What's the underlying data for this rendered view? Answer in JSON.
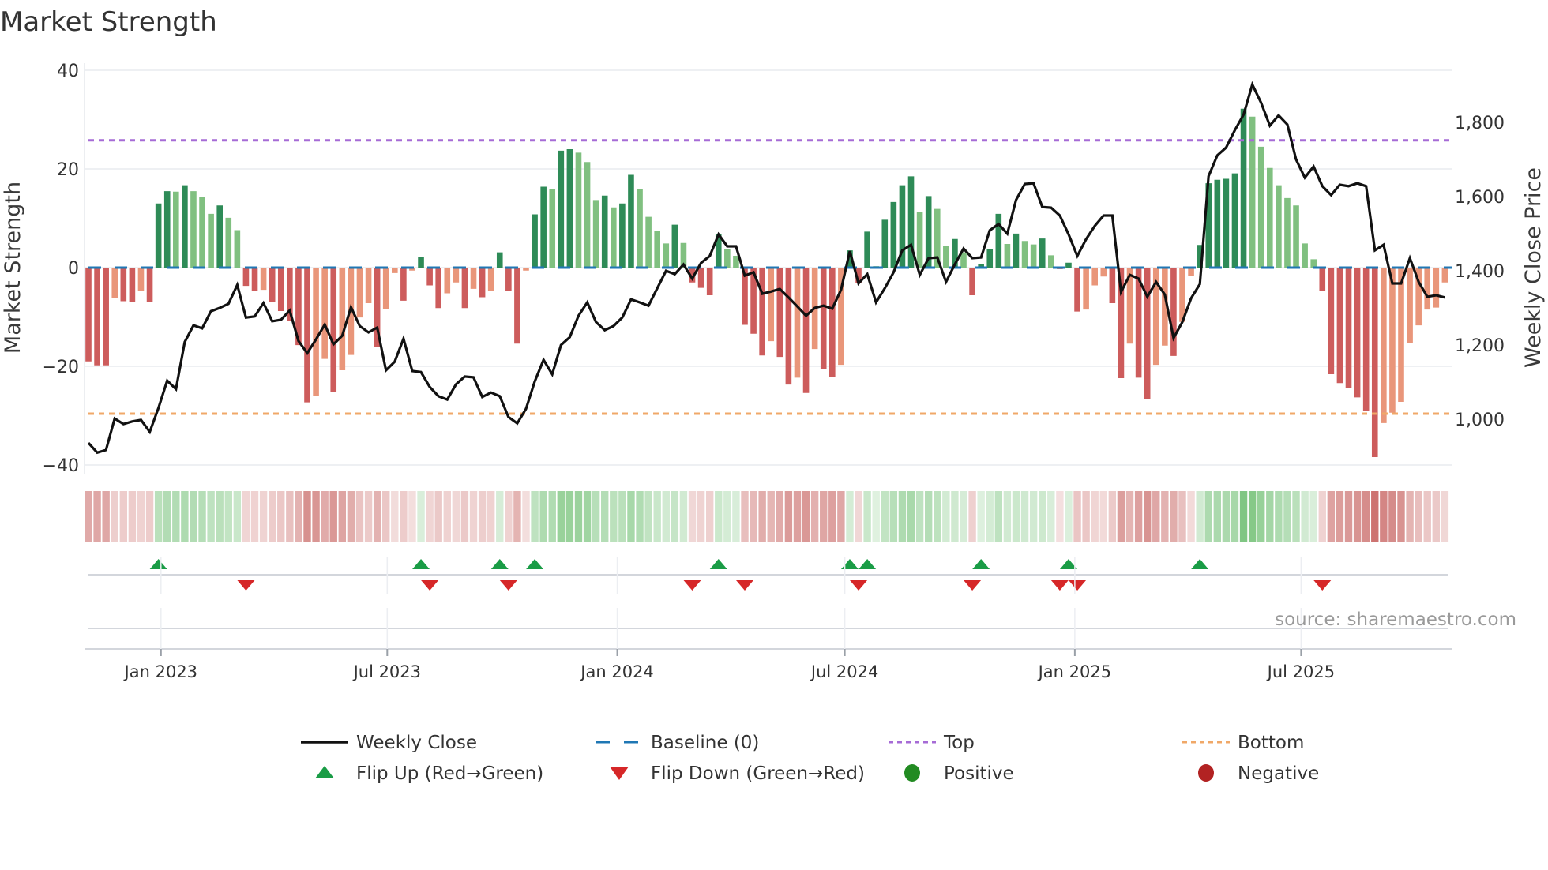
{
  "chart_data": {
    "type": "bar",
    "title": "Market Strength",
    "ylabel": "Market Strength",
    "y2label": "Weekly Close Price",
    "ylim": [
      -40,
      40
    ],
    "y2lim": [
      880,
      1930
    ],
    "yticks": [
      "40",
      "20",
      "0",
      "−20",
      "−40"
    ],
    "ytick_values": [
      40,
      20,
      0,
      -20,
      -40
    ],
    "y2ticks": [
      "1,000",
      "1,200",
      "1,400",
      "1,600",
      "1,800"
    ],
    "y2tick_values": [
      1000,
      1200,
      1400,
      1600,
      1800
    ],
    "x_start": "2022-11-04",
    "x_step_days": 7,
    "xticks": [
      {
        "label": "Jan 2023",
        "date": "2023-01-01"
      },
      {
        "label": "Jul 2023",
        "date": "2023-07-01"
      },
      {
        "label": "Jan 2024",
        "date": "2024-01-01"
      },
      {
        "label": "Jul 2024",
        "date": "2024-07-01"
      },
      {
        "label": "Jan 2025",
        "date": "2025-01-01"
      },
      {
        "label": "Jul 2025",
        "date": "2025-07-01"
      }
    ],
    "top_level": 25.8,
    "bottom_level": -29.6,
    "strength": [
      -19,
      -19.8,
      -19.8,
      -6.2,
      -6.8,
      -6.9,
      -4.8,
      -6.9,
      13,
      15.5,
      15.4,
      16.7,
      15.5,
      14.3,
      10.9,
      12.6,
      10.1,
      7.6,
      -3.7,
      -4.8,
      -4.5,
      -6.9,
      -8.8,
      -10.8,
      -15.7,
      -27.3,
      -26,
      -18.5,
      -25.2,
      -20.8,
      -17.7,
      -10.1,
      -7.2,
      -16,
      -8.4,
      -1.1,
      -6.7,
      -0.6,
      2.1,
      -3.6,
      -8.2,
      -5.2,
      -3,
      -8.2,
      -4.3,
      -6,
      -4.8,
      3.1,
      -4.8,
      -15.4,
      -0.6,
      10.8,
      16.4,
      15.9,
      23.7,
      24,
      23.3,
      21.4,
      13.7,
      14.6,
      12.2,
      13,
      18.8,
      15.9,
      10.3,
      7.4,
      4.9,
      8.7,
      5,
      -3,
      -4.1,
      -5.6,
      6.8,
      3.8,
      2.4,
      -11.6,
      -13.4,
      -17.8,
      -14.9,
      -18.1,
      -23.7,
      -22.3,
      -25.4,
      -16.5,
      -20.5,
      -22.1,
      -19.7,
      3.5,
      -3.2,
      7.3,
      0.3,
      9.7,
      13.3,
      16.7,
      18.5,
      11.3,
      14.5,
      11.9,
      4.4,
      5.8,
      3.1,
      -5.6,
      0.7,
      3.7,
      10.9,
      4.8,
      6.9,
      5.4,
      4.7,
      5.9,
      2.5,
      -0.3,
      1,
      -8.9,
      -8.5,
      -3.6,
      -1.8,
      -7.2,
      -22.4,
      -15.4,
      -22.3,
      -26.6,
      -19.7,
      -15.8,
      -17.9,
      -11,
      -1.6,
      4.6,
      17.1,
      17.8,
      18,
      19.1,
      32.2,
      30.6,
      24.5,
      20.2,
      16.7,
      14.1,
      12.6,
      4.9,
      1.7,
      -4.7,
      -21.6,
      -23.4,
      -24.4,
      -26.3,
      -29.1,
      -38.4,
      -31.5,
      -29.4,
      -27.2,
      -15.2,
      -11.7,
      -8.5,
      -8.1,
      -3
    ],
    "weekly_close": [
      936,
      910,
      917,
      1002,
      987,
      994,
      998,
      966,
      1030,
      1104,
      1081,
      1208,
      1253,
      1245,
      1291,
      1300,
      1311,
      1362,
      1274,
      1277,
      1313,
      1264,
      1268,
      1293,
      1211,
      1178,
      1215,
      1255,
      1202,
      1225,
      1302,
      1251,
      1234,
      1247,
      1132,
      1155,
      1217,
      1130,
      1127,
      1087,
      1062,
      1053,
      1094,
      1115,
      1113,
      1060,
      1072,
      1062,
      1006,
      989,
      1028,
      1102,
      1160,
      1121,
      1200,
      1221,
      1279,
      1315,
      1262,
      1240,
      1251,
      1274,
      1323,
      1315,
      1306,
      1353,
      1400,
      1391,
      1417,
      1379,
      1421,
      1440,
      1498,
      1466,
      1466,
      1387,
      1396,
      1338,
      1344,
      1351,
      1328,
      1304,
      1279,
      1300,
      1306,
      1298,
      1349,
      1453,
      1366,
      1391,
      1315,
      1353,
      1396,
      1455,
      1470,
      1389,
      1434,
      1436,
      1370,
      1417,
      1460,
      1434,
      1436,
      1509,
      1526,
      1500,
      1591,
      1634,
      1636,
      1572,
      1570,
      1549,
      1498,
      1440,
      1485,
      1521,
      1549,
      1549,
      1343,
      1389,
      1379,
      1330,
      1370,
      1336,
      1219,
      1262,
      1326,
      1364,
      1655,
      1711,
      1732,
      1779,
      1821,
      1902,
      1853,
      1791,
      1819,
      1794,
      1700,
      1651,
      1681,
      1628,
      1604,
      1632,
      1628,
      1636,
      1628,
      1455,
      1470,
      1366,
      1366,
      1434,
      1370,
      1330,
      1334,
      1328
    ],
    "flip_up_weeks": [
      8,
      38,
      47,
      51,
      72,
      87,
      89,
      102,
      112,
      127
    ],
    "flip_down_weeks": [
      18,
      39,
      48,
      69,
      75,
      88,
      101,
      111,
      113,
      141
    ],
    "legend": {
      "placement": "bottom",
      "items": [
        {
          "label": "Weekly Close",
          "kind": "line"
        },
        {
          "label": "Baseline (0)",
          "kind": "dash"
        },
        {
          "label": "Top",
          "kind": "dot-purple"
        },
        {
          "label": "Bottom",
          "kind": "dot-orange"
        },
        {
          "label": "Flip Up (Red→Green)",
          "kind": "tri-up"
        },
        {
          "label": "Flip Down (Green→Red)",
          "kind": "tri-down"
        },
        {
          "label": "Positive",
          "kind": "dot-green"
        },
        {
          "label": "Negative",
          "kind": "dot-red"
        }
      ]
    },
    "source": "source: sharemaestro.com",
    "colors": {
      "pos_dark": "#2e8b57",
      "pos_light": "#80c080",
      "neg_dark": "#cd5c5c",
      "neg_light": "#e9967a",
      "baseline": "#1f77b4",
      "top": "#a66bd6",
      "bottom": "#f0a868",
      "flip_up": "#1a9c46",
      "flip_down": "#d62728",
      "positive": "#228b22",
      "negative": "#b22222",
      "price": "#111111"
    }
  }
}
